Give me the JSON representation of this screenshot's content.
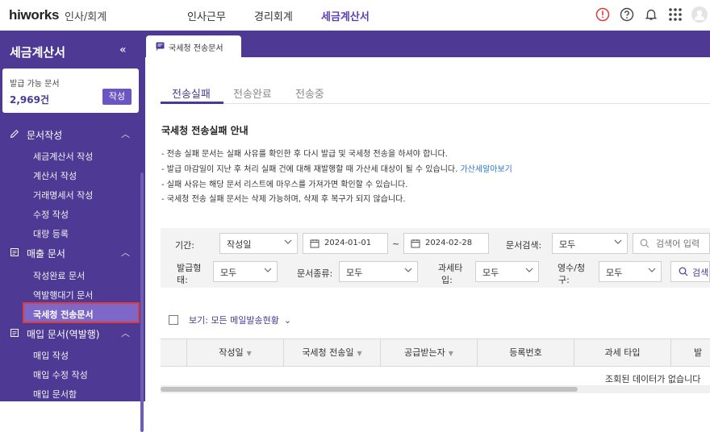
{
  "header": {
    "logo": "hiworks",
    "app_name": "인사/회계",
    "nav": [
      "인사근무",
      "경리회계",
      "세금계산서"
    ],
    "active_nav": "세금계산서"
  },
  "sidebar": {
    "title": "세금계산서",
    "collapse": "«",
    "card": {
      "label": "발급 가능 문서",
      "count": "2,969건",
      "button": "작성"
    },
    "sections": [
      {
        "label": "문서작성",
        "items": [
          "세금계산서 작성",
          "계산서 작성",
          "거래명세서 작성",
          "수정 작성",
          "대량 등록"
        ]
      },
      {
        "label": "매출 문서",
        "items": [
          "작성완료 문서",
          "역발행대기 문서",
          "국세청 전송문서"
        ]
      },
      {
        "label": "매입 문서(역발행)",
        "items": [
          "매입 작성",
          "매입 수정 작성",
          "매입 문서함"
        ]
      }
    ],
    "active_item": "국세청 전송문서"
  },
  "page_tab": {
    "label": "국세청 전송문서"
  },
  "subtabs": [
    "전송실패",
    "전송완료",
    "전송중"
  ],
  "active_subtab": "전송실패",
  "guide": {
    "title": "국세청 전송실패 안내",
    "lines": [
      "- 전송 실패 문서는 실패 사유를 확인한 후 다시 발급 및 국세청 전송을 하셔야 합니다.",
      "- 발급 마감일이 지난 후 처리 실패 건에 대해 재발행할 때 가산세 대상이 될 수 있습니다.",
      "- 실패 사유는 해당 문서 리스트에 마우스를 가져가면 확인할 수 있습니다.",
      "- 국세청 전송 실패 문서는 삭제 가능하며, 삭제 후 복구가 되지 않습니다."
    ],
    "link": "가산세알아보기"
  },
  "filters": {
    "period_label": "기간:",
    "period_type": "작성일",
    "date_from": "2024-01-01",
    "date_sep": "~",
    "date_to": "2024-02-28",
    "doc_search_label": "문서검색:",
    "doc_search_value": "모두",
    "search_placeholder": "검색어 입력",
    "issue_type_label_1": "발급형",
    "issue_type_label_2": "태:",
    "issue_type_value": "모두",
    "doc_kind_label": "문서종류:",
    "doc_kind_value": "모두",
    "tax_type_label_1": "과세타",
    "tax_type_label_2": "입:",
    "tax_type_value": "모두",
    "receipt_label_1": "영수/청",
    "receipt_label_2": "구:",
    "receipt_value": "모두",
    "search_button": "검색"
  },
  "view_selector": "보기: 모든 메일발송현황",
  "table": {
    "columns": [
      "작성일",
      "국세청 전송일",
      "공급받는자",
      "등록번호",
      "과세 타입",
      "발"
    ],
    "empty_message": "조회된 데이터가 없습니다"
  },
  "colors": {
    "brand": "#4e3a94",
    "accent": "#4a3a96",
    "highlight_border": "#e23a3a"
  }
}
